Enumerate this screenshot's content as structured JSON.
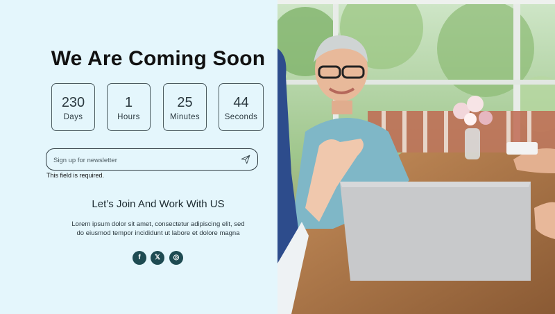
{
  "hero": {
    "title": "We Are Coming Soon"
  },
  "countdown": [
    {
      "value": "230",
      "label": "Days"
    },
    {
      "value": "1",
      "label": "Hours"
    },
    {
      "value": "25",
      "label": "Minutes"
    },
    {
      "value": "44",
      "label": "Seconds"
    }
  ],
  "newsletter": {
    "placeholder": "Sign up for newsletter",
    "error": "This field is required."
  },
  "join": {
    "heading": "Let’s Join And Work With US",
    "text_line1": "Lorem ipsum dolor sit amet, consectetur adipiscing elit, sed",
    "text_line2": "do eiusmod tempor incididunt ut labore et dolore magna"
  },
  "social": [
    {
      "icon": "facebook-icon",
      "glyph": "f"
    },
    {
      "icon": "x-icon",
      "glyph": "𝕏"
    },
    {
      "icon": "instagram-icon",
      "glyph": "◎"
    }
  ],
  "colors": {
    "panel": "#e4f6fc",
    "social": "#1e4b52"
  }
}
